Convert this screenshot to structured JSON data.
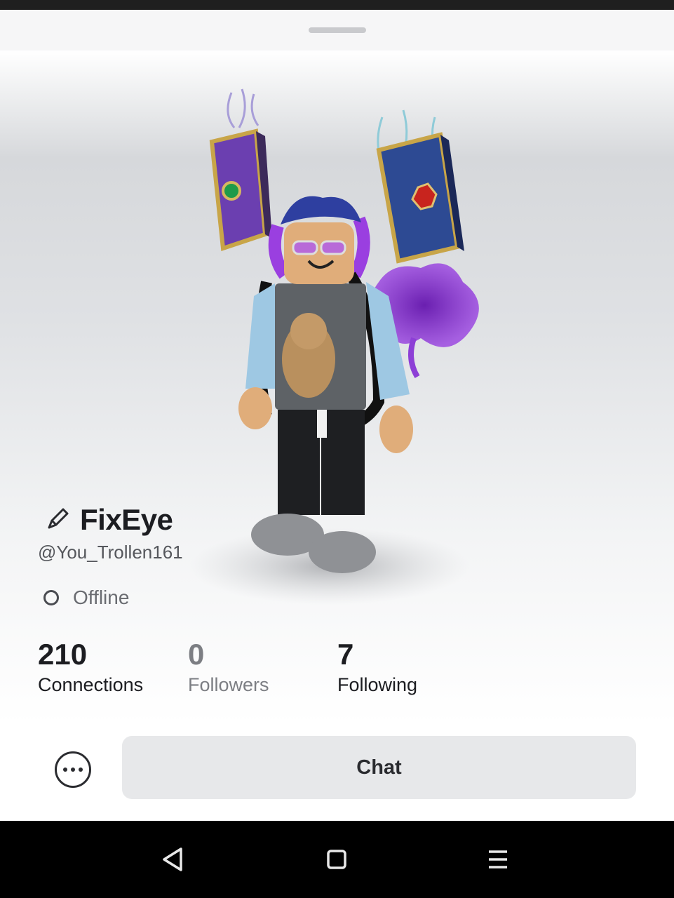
{
  "sheet": {
    "drag_handle": "sheet-drag-handle"
  },
  "profile": {
    "display_name": "FixEye",
    "username": "@You_Trollen161",
    "edit_icon": "pencil-icon",
    "status": "Offline"
  },
  "stats": [
    {
      "value": "210",
      "label": "Connections"
    },
    {
      "value": "0",
      "label": "Followers"
    },
    {
      "value": "7",
      "label": "Following"
    }
  ],
  "actions": {
    "more_icon": "more-options-icon",
    "chat_label": "Chat"
  },
  "navbar": {
    "back_icon": "back-triangle-icon",
    "home_icon": "home-square-icon",
    "menu_icon": "menu-lines-icon"
  },
  "colors": {
    "primary_text": "#1c1d21",
    "muted_text": "#7c7e83",
    "chat_button_bg": "#e7e8ea"
  }
}
